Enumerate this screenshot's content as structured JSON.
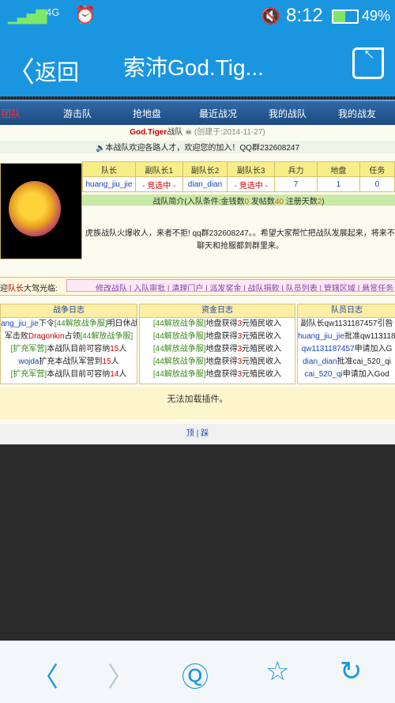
{
  "statusbar": {
    "signal_icon": "signal-bars-icon",
    "network": "4G",
    "alarm_icon": "alarm-clock-icon",
    "mute_icon": "mute-icon",
    "time": "8:12",
    "battery_icon": "battery-icon",
    "battery_level": 0.49,
    "battery": "49%"
  },
  "titlebar": {
    "back_label": "返回",
    "title": "索沛God.Tig...",
    "share_icon": "share-icon"
  },
  "nav": {
    "items": [
      "团队",
      "游击队",
      "抢地盘",
      "最近战况",
      "我的战队",
      "我的战友"
    ]
  },
  "team": {
    "name_red": "God.Tiger",
    "name_suffix": "战队",
    "created": "(创建于:2014-11-27)",
    "welcome": "本战队欢迎各路人才，欢迎您的加入！QQ群232608247",
    "stats_headers": [
      "队长",
      "副队长1",
      "副队长2",
      "副队长3",
      "兵力",
      "地盘",
      "任务"
    ],
    "stats_values": [
      "huang_jiu_jie",
      "- 竞选中 -",
      "dian_dian",
      "- 竞选中 -",
      "7",
      "1",
      "0"
    ],
    "intro_prefix": "战队简介(入队条件:金钱数",
    "intro_money": "0",
    "intro_mid": " 发帖数",
    "intro_posts": "40",
    "intro_mid2": " 注册天数",
    "intro_days": "2",
    "intro_suffix": ")",
    "intro_line1": "虎族战队火爆收人，来者不拒! qq群232608247。。希望大家帮忙把战队发展起来，将来不会",
    "intro_line2": "聊天和抢服都到群里来。"
  },
  "linkbar": {
    "label_prefix": "迎",
    "label_red": "队长",
    "label_suffix": "大驾光临:",
    "links": "修改战队 | 入队审批 | 清理门户 | 派发奖金 | 战队捐款 | 队员列表 | 管辖区域 | 悬赏任务 | 退位"
  },
  "logs": {
    "war": {
      "title": "战争日志",
      "rows": [
        [
          "ang_jiu_jie",
          "下令",
          "[44解放战争服]",
          "明日休战"
        ],
        [
          "军击败",
          "Dragonkin",
          "占领",
          "[44解放战争服]"
        ],
        [
          "[扩充军营]",
          "本战队目前可容纳",
          "15",
          "人"
        ],
        [
          "wojda",
          "扩充本战队军营到",
          "15",
          "人"
        ],
        [
          "[扩充军营]",
          "本战队目前可容纳",
          "14",
          "人"
        ]
      ]
    },
    "fund": {
      "title": "资金日志",
      "rows": [
        [
          "[44解放战争服]",
          "地盘获得",
          "3",
          "元殖民收入"
        ],
        [
          "[44解放战争服]",
          "地盘获得",
          "3",
          "元殖民收入"
        ],
        [
          "[44解放战争服]",
          "地盘获得",
          "3",
          "元殖民收入"
        ],
        [
          "[44解放战争服]",
          "地盘获得",
          "3",
          "元殖民收入"
        ],
        [
          "[44解放战争服]",
          "地盘获得",
          "3",
          "元殖民收入"
        ]
      ]
    },
    "member": {
      "title": "队员日志",
      "rows": [
        [
          "副队长qw1131187457引咎"
        ],
        [
          "huang_jiu_jie",
          "批准qw1131187"
        ],
        [
          "qw1131187457",
          "申请加入G"
        ],
        [
          "dian_dian",
          "批准cai_520_qi"
        ],
        [
          "cai_520_qi",
          "申请加入God"
        ]
      ]
    }
  },
  "plugin_msg": "无法加载插件。",
  "footer": "顶 | 踩",
  "toolbar": {
    "back_icon": "arrow-left-icon",
    "forward_icon": "arrow-right-icon",
    "chat_icon": "chat-bubble-icon",
    "bookmark_icon": "star-bookmark-icon",
    "refresh_icon": "refresh-icon"
  },
  "colors": {
    "accent": "#1a96e0",
    "nav": "#2f6aa8",
    "highlight_red": "#cc0000"
  }
}
